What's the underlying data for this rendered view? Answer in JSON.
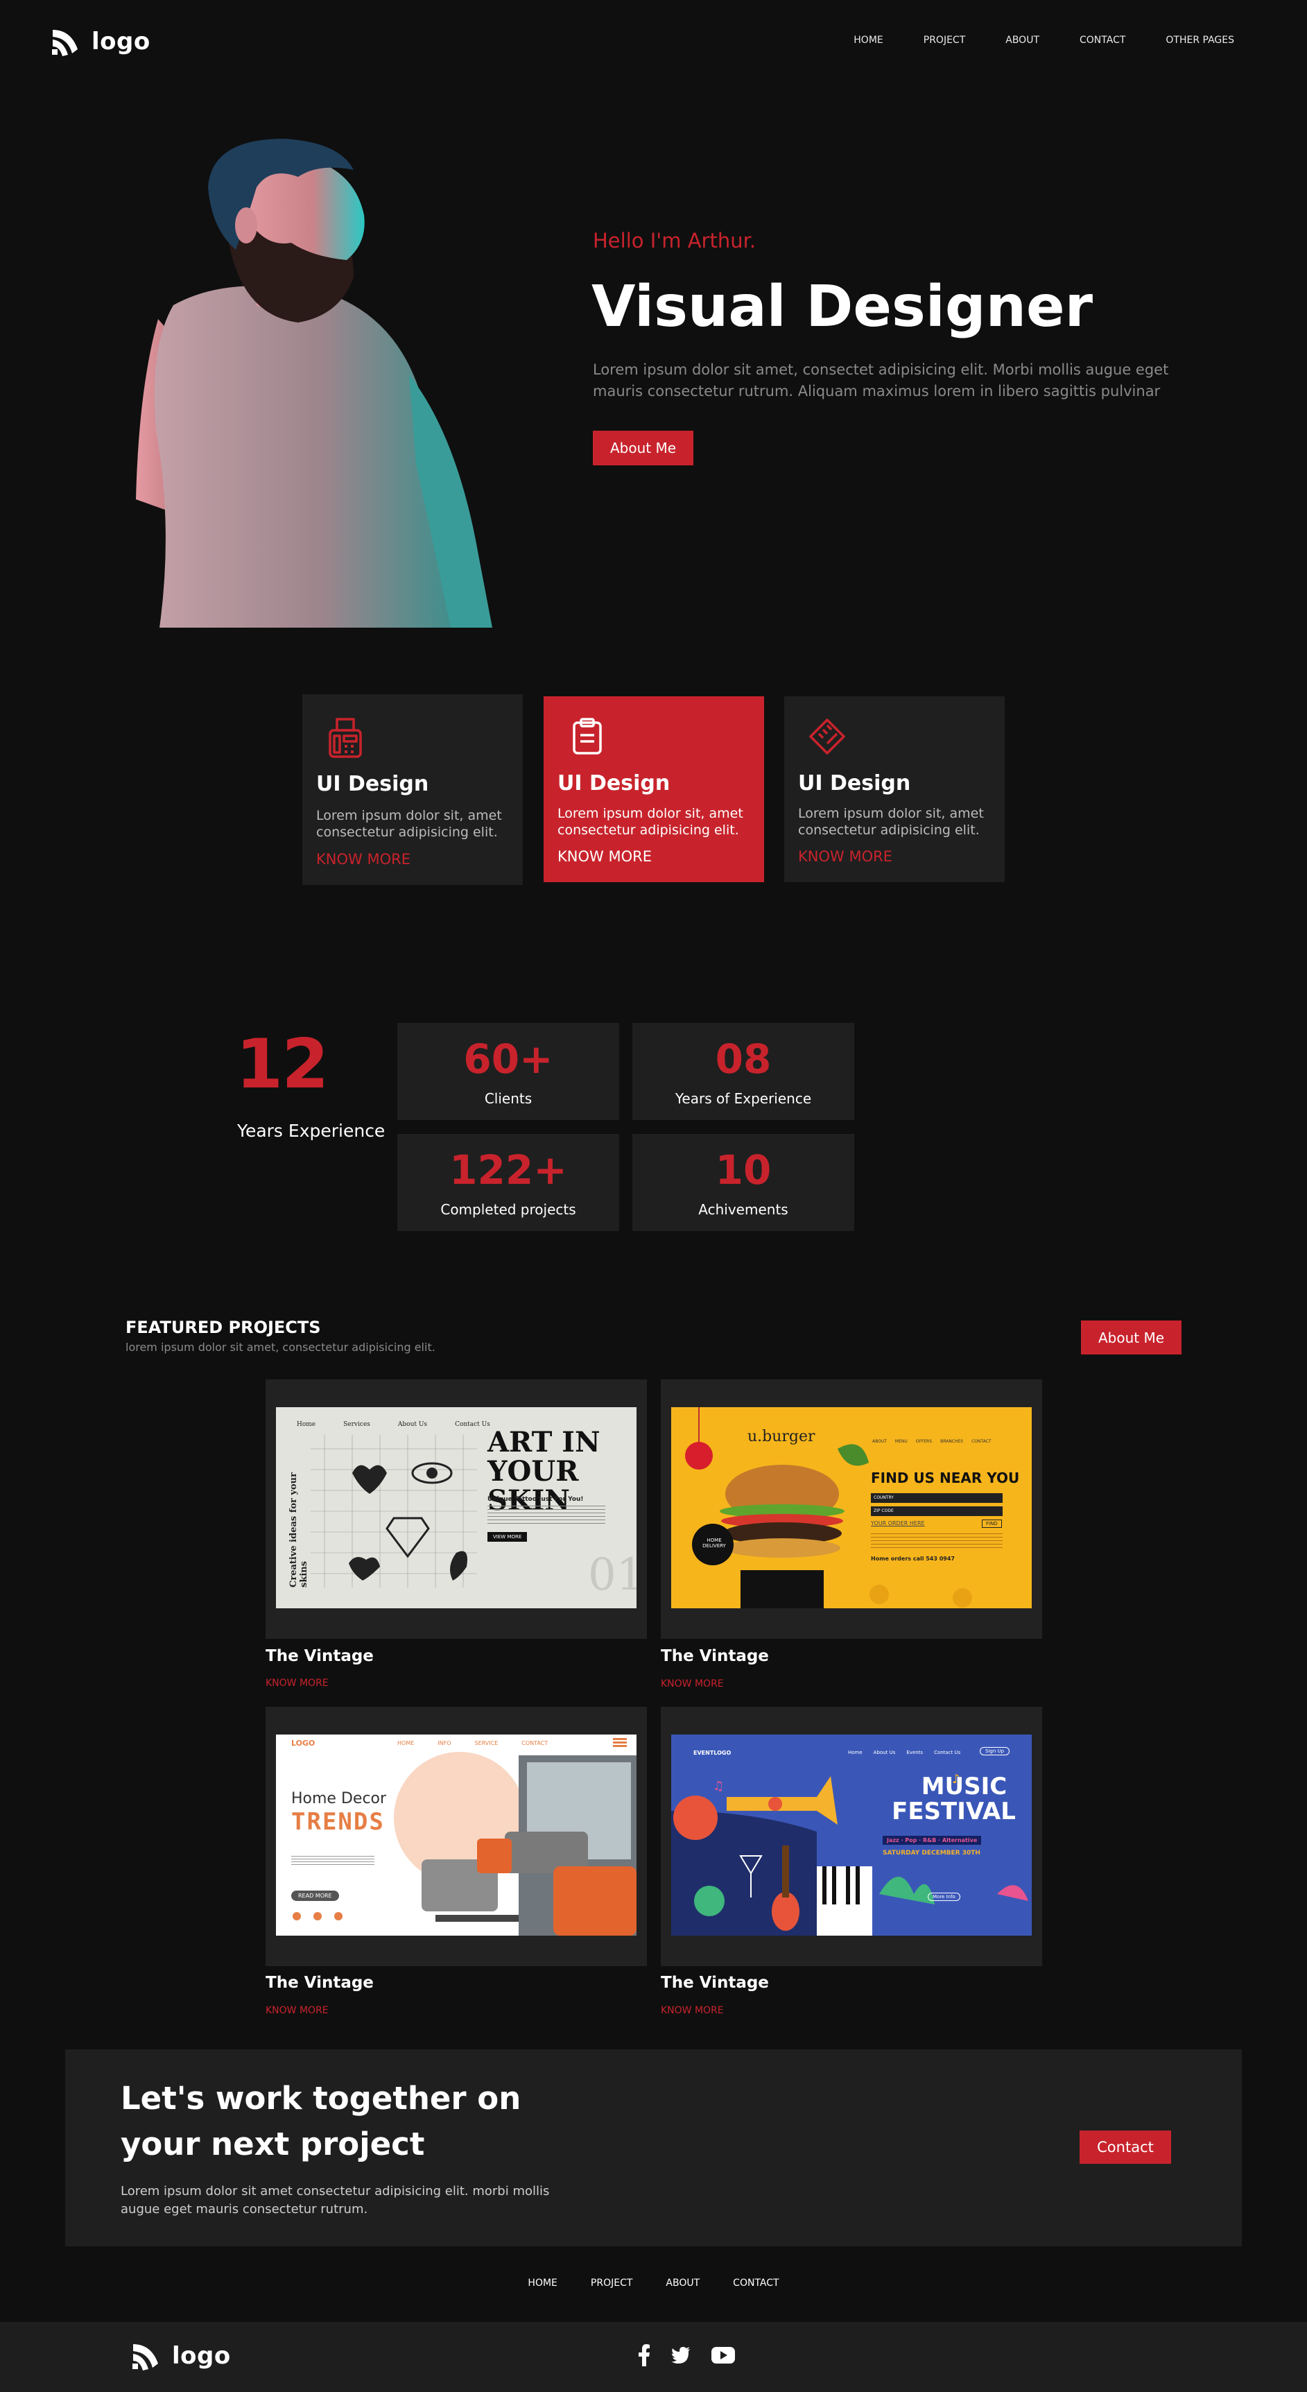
{
  "brand": {
    "logo_text": "logo"
  },
  "nav": {
    "items": [
      "HOME",
      "PROJECT",
      "ABOUT",
      "CONTACT",
      "OTHER PAGES"
    ]
  },
  "hero": {
    "greeting": "Hello I'm Arthur.",
    "title": "Visual Designer",
    "description": "Lorem ipsum dolor sit amet, consectet adipisicing elit. Morbi mollis augue eget mauris consectetur rutrum. Aliquam maximus lorem in libero sagittis pulvinar",
    "button": "About Me"
  },
  "services": [
    {
      "title": "UI Design",
      "text": "Lorem ipsum dolor sit, amet consectetur adipisicing elit.",
      "link": "KNOW MORE",
      "icon": "fax-machine-icon"
    },
    {
      "title": "UI Design",
      "text": "Lorem ipsum dolor sit, amet consectetur adipisicing elit.",
      "link": "KNOW MORE",
      "icon": "clipboard-icon"
    },
    {
      "title": "UI Design",
      "text": "Lorem ipsum dolor sit, amet consectetur adipisicing elit.",
      "link": "KNOW MORE",
      "icon": "ruler-pencil-icon"
    }
  ],
  "experience": {
    "number": "12",
    "label": "Years Experience"
  },
  "stats": [
    {
      "value": "60+",
      "label": "Clients"
    },
    {
      "value": "08",
      "label": "Years of Experience"
    },
    {
      "value": "122+",
      "label": "Completed projects"
    },
    {
      "value": "10",
      "label": "Achivements"
    }
  ],
  "featured": {
    "title": "FEATURED PROJECTS",
    "subtitle": "lorem ipsum dolor sit amet, consectetur adipisicing elit.",
    "button": "About Me",
    "projects": [
      {
        "name": "The Vintage",
        "link": "KNOW MORE",
        "shot": {
          "nav": [
            "Home",
            "Services",
            "About Us",
            "Contact Us"
          ],
          "headline": "ART IN YOUR SKIN",
          "side_text": "Creative ideas for your skins",
          "sub": "Unique Tattoo Just For You!",
          "cta": "VIEW MORE",
          "number": "01"
        }
      },
      {
        "name": "The Vintage",
        "link": "KNOW MORE",
        "shot": {
          "brand": "u.burger",
          "nav": [
            "ABOUT",
            "MENU",
            "OFFERS",
            "BRANCHES",
            "CONTACT"
          ],
          "headline": "FIND US NEAR YOU",
          "fields": [
            "COUNTRY",
            "ZIP CODE"
          ],
          "order_label": "YOUR ORDER HERE",
          "find": "FIND",
          "badge": "HOME DELIVERY",
          "phone": "Home orders call 543 0947"
        }
      },
      {
        "name": "The Vintage",
        "link": "KNOW MORE",
        "shot": {
          "brand": "LOGO",
          "nav": [
            "HOME",
            "INFO",
            "SERVICE",
            "CONTACT"
          ],
          "headline_1": "Home  Decor",
          "headline_2": "TRENDS",
          "cta": "READ MORE"
        }
      },
      {
        "name": "The Vintage",
        "link": "KNOW MORE",
        "shot": {
          "brand": "EVENTLOGO",
          "nav": [
            "Home",
            "About Us",
            "Events",
            "Contact Us"
          ],
          "signup": "Sign Up",
          "headline_1": "MUSIC",
          "headline_2": "FESTIVAL",
          "genres": "Jazz · Pop · R&B · Alternative",
          "date": "SATURDAY DECEMBER 30TH",
          "cta": "More Info"
        }
      }
    ]
  },
  "cta": {
    "title": "Let's work together on your next project",
    "text": "Lorem ipsum dolor sit amet consectetur adipisicing elit. morbi mollis augue eget mauris consectetur rutrum.",
    "button": "Contact"
  },
  "footer": {
    "nav": [
      "HOME",
      "PROJECT",
      "ABOUT",
      "CONTACT"
    ],
    "logo_text": "logo",
    "socials": [
      "facebook-icon",
      "twitter-icon",
      "youtube-icon"
    ]
  },
  "colors": {
    "accent": "#c8232c",
    "background": "#0f0f0f",
    "card": "#1f1f1f",
    "muted": "#8a8a8a"
  }
}
